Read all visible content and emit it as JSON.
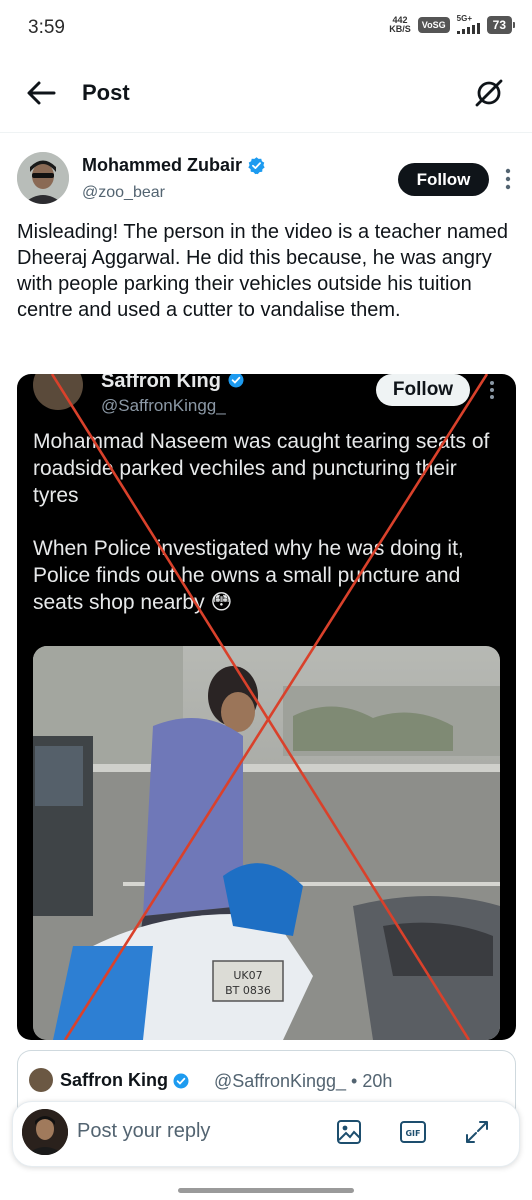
{
  "status_bar": {
    "time": "3:59",
    "net_speed_value": "442",
    "net_speed_unit": "KB/S",
    "vo_badge": "VoSG",
    "signal_label": "5G+",
    "battery": "73"
  },
  "header": {
    "title": "Post",
    "back_icon": "arrow-left-icon",
    "grok_icon": "grok-icon"
  },
  "tweet": {
    "author_name": "Mohammed Zubair",
    "author_handle": "@zoo_bear",
    "follow_label": "Follow",
    "text": "Misleading! The person in the video is a teacher named Dheeraj Aggarwal. He did this because, he was angry with people parking their vehicles outside his tuition centre and used a cutter to vandalise them."
  },
  "embedded_post": {
    "name": "Saffron King",
    "handle": "@SaffronKingg_",
    "follow_label": "Follow",
    "paragraph_1": "Mohammad Naseem was caught tearing seats of roadside parked vechiles and puncturing their tyres",
    "paragraph_2": "When Police investigated why he was doing it, Police finds out he owns a small puncture and seats shop nearby 😳",
    "plate_text": "UK07 BT 0836",
    "cross_color": "#d9412b"
  },
  "quote": {
    "name": "Saffron King",
    "handle_time": "@SaffronKingg_ • 20h"
  },
  "reply_bar": {
    "placeholder": "Post your reply",
    "icons": [
      "image-icon",
      "gif-icon",
      "expand-icon"
    ],
    "gif_label": "GIF"
  },
  "colors": {
    "text_primary": "#0f1419",
    "text_secondary": "#536471",
    "verified_blue": "#1d9bf0",
    "follow_bg": "#0f1419"
  }
}
